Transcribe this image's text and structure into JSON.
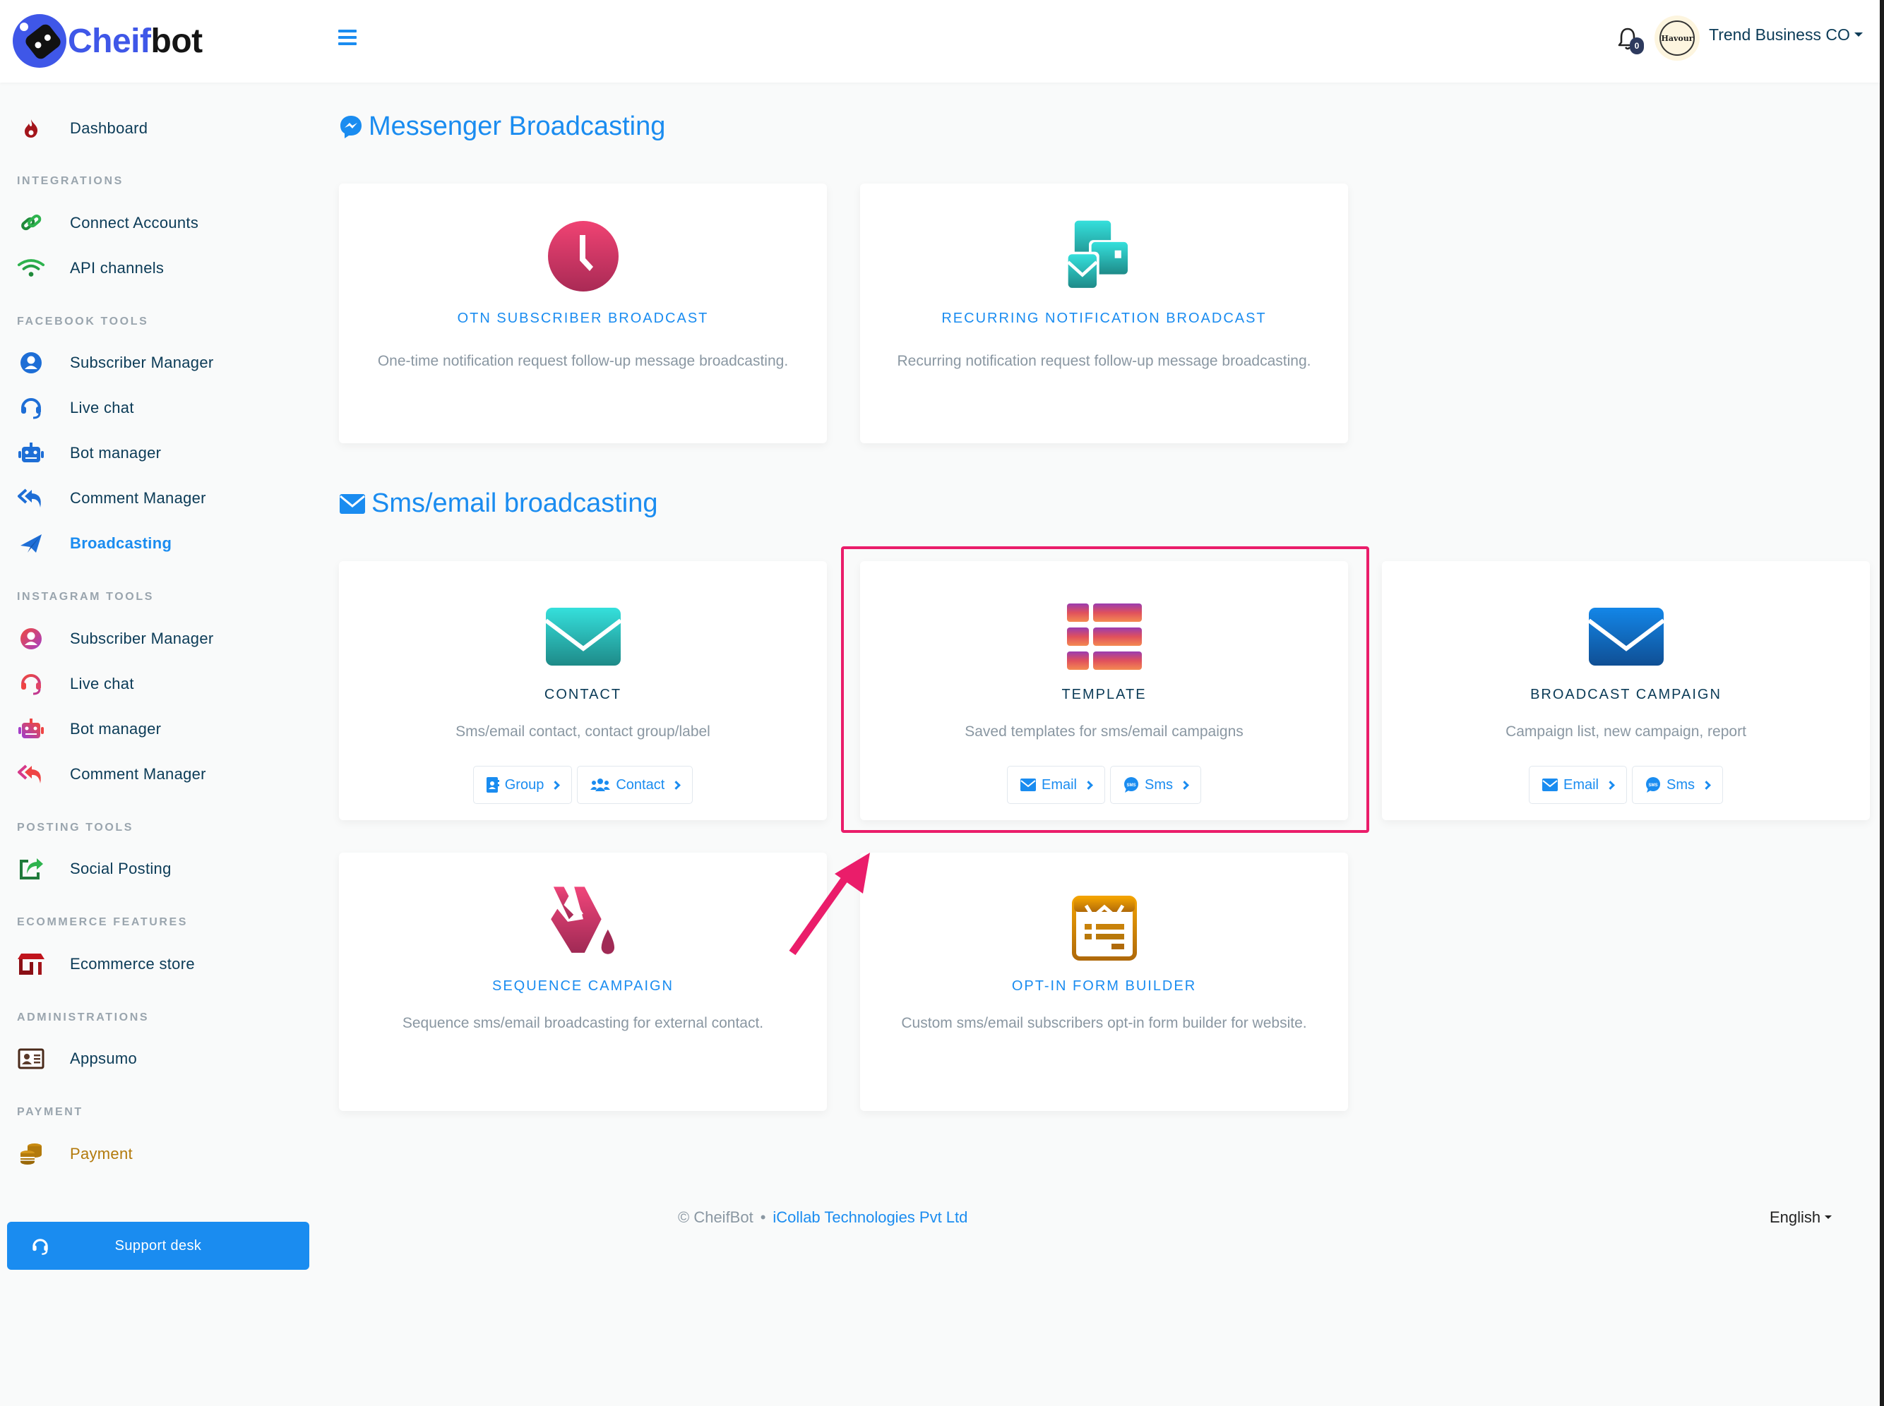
{
  "app": {
    "logo_part1": "Cheif",
    "logo_part2": "bot"
  },
  "header": {
    "notification_count": "0",
    "avatar_text": "Havour",
    "account_name": "Trend Business CO"
  },
  "sidebar": {
    "dashboard": "Dashboard",
    "sections": {
      "integrations": "INTEGRATIONS",
      "facebook_tools": "FACEBOOK TOOLS",
      "instagram_tools": "INSTAGRAM TOOLS",
      "posting_tools": "POSTING TOOLS",
      "ecommerce_features": "ECOMMERCE FEATURES",
      "administrations": "ADMINISTRATIONS",
      "payment": "PAYMENT"
    },
    "items": {
      "connect_accounts": "Connect Accounts",
      "api_channels": "API channels",
      "fb_subscriber_manager": "Subscriber Manager",
      "fb_live_chat": "Live chat",
      "fb_bot_manager": "Bot manager",
      "fb_comment_manager": "Comment Manager",
      "fb_broadcasting": "Broadcasting",
      "ig_subscriber_manager": "Subscriber Manager",
      "ig_live_chat": "Live chat",
      "ig_bot_manager": "Bot manager",
      "ig_comment_manager": "Comment Manager",
      "social_posting": "Social Posting",
      "ecommerce_store": "Ecommerce store",
      "appsumo": "Appsumo",
      "payment": "Payment"
    },
    "active_item": "Broadcasting",
    "support_desk": "Support desk"
  },
  "main": {
    "messenger_heading": "Messenger Broadcasting",
    "sms_email_heading": "Sms/email broadcasting",
    "cards": {
      "otn": {
        "title": "OTN SUBSCRIBER BROADCAST",
        "description": "One-time notification request follow-up message broadcasting."
      },
      "recurring": {
        "title": "RECURRING NOTIFICATION BROADCAST",
        "description": "Recurring notification request follow-up message broadcasting."
      },
      "contact": {
        "title": "CONTACT",
        "description": "Sms/email contact, contact group/label",
        "buttons": [
          "Group",
          "Contact"
        ]
      },
      "template": {
        "title": "TEMPLATE",
        "description": "Saved templates for sms/email campaigns",
        "buttons": [
          "Email",
          "Sms"
        ]
      },
      "broadcast_campaign": {
        "title": "BROADCAST CAMPAIGN",
        "description": "Campaign list, new campaign, report",
        "buttons": [
          "Email",
          "Sms"
        ]
      },
      "sequence": {
        "title": "SEQUENCE CAMPAIGN",
        "description": "Sequence sms/email broadcasting for external contact."
      },
      "optin": {
        "title": "OPT-IN FORM BUILDER",
        "description": "Custom sms/email subscribers opt-in form builder for website."
      }
    }
  },
  "footer": {
    "copyright": "© CheifBot",
    "separator": "•",
    "company_link": "iCollab Technologies Pvt Ltd",
    "language": "English"
  },
  "colors": {
    "accent": "#1a8cf0",
    "text_dark": "#0b3b57",
    "highlight": "#ea1d6a"
  }
}
